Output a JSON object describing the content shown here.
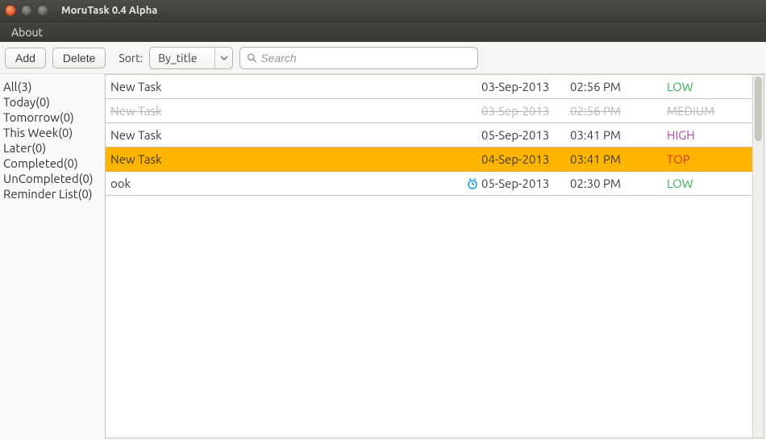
{
  "window": {
    "title": "MoruTask 0.4 Alpha"
  },
  "menubar": {
    "about": "About"
  },
  "toolbar": {
    "add_label": "Add",
    "delete_label": "Delete",
    "sort_label": "Sort:",
    "sort_value": "By_title",
    "search_placeholder": "Search"
  },
  "sidebar": {
    "items": [
      {
        "label": "All(3)"
      },
      {
        "label": "Today(0)"
      },
      {
        "label": "Tomorrow(0)"
      },
      {
        "label": "This Week(0)"
      },
      {
        "label": "Later(0)"
      },
      {
        "label": "Completed(0)"
      },
      {
        "label": "UnCompleted(0)"
      },
      {
        "label": "Reminder List(0)"
      }
    ]
  },
  "tasks": [
    {
      "title": "New Task",
      "date": "03-Sep-2013",
      "time": "02:56 PM",
      "priority": "LOW",
      "pri_class": "pri-low",
      "completed": false,
      "selected": false,
      "reminder": false
    },
    {
      "title": "New Task",
      "date": "03-Sep-2013",
      "time": "02:56 PM",
      "priority": "MEDIUM",
      "pri_class": "pri-medium",
      "completed": true,
      "selected": false,
      "reminder": false
    },
    {
      "title": "New Task",
      "date": "05-Sep-2013",
      "time": "03:41 PM",
      "priority": "HIGH",
      "pri_class": "pri-high",
      "completed": false,
      "selected": false,
      "reminder": false
    },
    {
      "title": "New Task",
      "date": "04-Sep-2013",
      "time": "03:41 PM",
      "priority": "TOP",
      "pri_class": "pri-top",
      "completed": false,
      "selected": true,
      "reminder": false
    },
    {
      "title": "ook",
      "date": "05-Sep-2013",
      "time": "02:30 PM",
      "priority": "LOW",
      "pri_class": "pri-low",
      "completed": false,
      "selected": false,
      "reminder": true
    }
  ]
}
